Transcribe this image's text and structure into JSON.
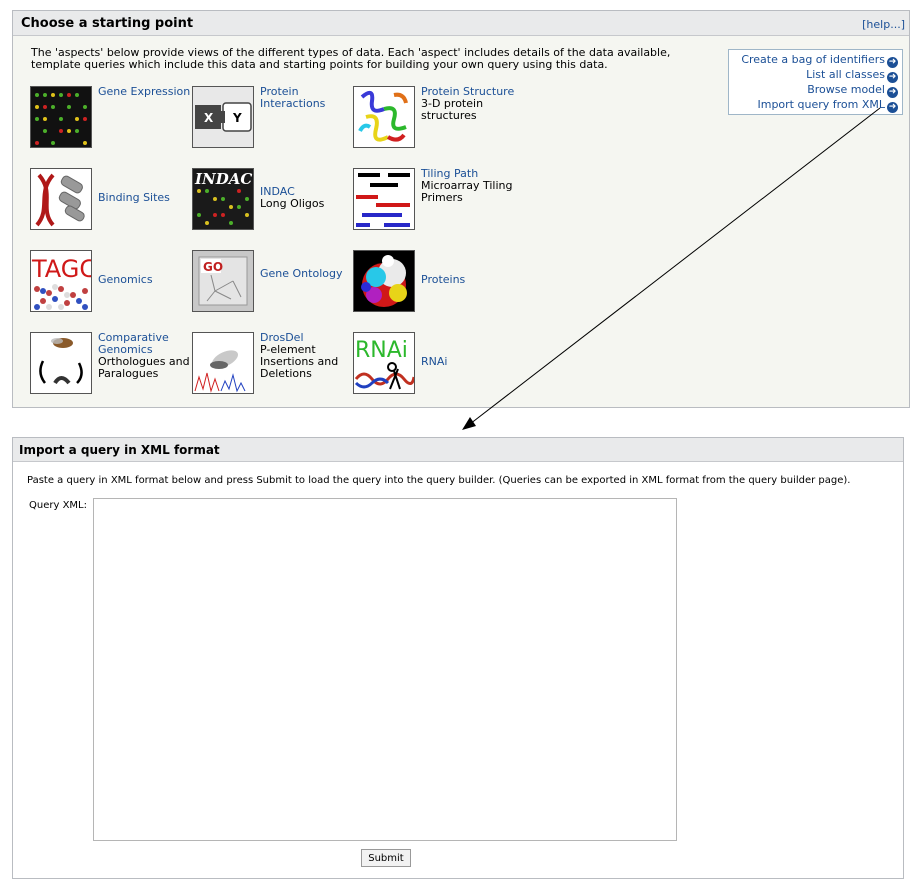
{
  "top_panel": {
    "title": "Choose a starting point",
    "help": "[help...]",
    "intro": "The 'aspects' below provide views of the different types of data. Each 'aspect' includes details of the data available, template queries which include this data and starting points for building your own query using this data.",
    "actions": [
      {
        "label": "Create a bag of identifiers",
        "icon": "arrow-circle-icon"
      },
      {
        "label": "List all classes",
        "icon": "arrow-circle-icon"
      },
      {
        "label": "Browse model",
        "icon": "arrow-circle-icon"
      },
      {
        "label": "Import query from XML",
        "icon": "arrow-circle-icon"
      }
    ],
    "aspects": [
      {
        "link": "Gene Expression",
        "sub": "",
        "icon": "microarray-icon"
      },
      {
        "link": "Protein Interactions",
        "sub": "",
        "icon": "xy-interaction-icon"
      },
      {
        "link": "Protein Structure",
        "sub": "3-D protein structures",
        "icon": "protein-ribbon-icon"
      },
      {
        "link": "Binding Sites",
        "sub": "",
        "icon": "dna-helix-icon"
      },
      {
        "link": "INDAC",
        "sub": "Long Oligos",
        "icon": "indac-icon"
      },
      {
        "link": "Tiling Path",
        "sub": "Microarray Tiling Primers",
        "icon": "tiling-bars-icon"
      },
      {
        "link": "Genomics",
        "sub": "",
        "icon": "tagc-icon"
      },
      {
        "link": "Gene Ontology",
        "sub": "",
        "icon": "go-graph-icon"
      },
      {
        "link": "Proteins",
        "sub": "",
        "icon": "protein-spheres-icon"
      },
      {
        "link": "Comparative Genomics",
        "sub": "Orthologues and Paralogues",
        "icon": "fly-cycle-icon"
      },
      {
        "link": "DrosDel",
        "sub": "P-element Insertions and Deletions",
        "icon": "fly-trace-icon"
      },
      {
        "link": "RNAi",
        "sub": "",
        "icon": "rnai-scissors-icon"
      }
    ],
    "indac_text": "INDAC",
    "tagc_text": "TAGC",
    "go_text": "GO",
    "rnai_text": "RNAi",
    "x_text": "X",
    "y_text": "Y"
  },
  "bottom_panel": {
    "title": "Import a query in XML format",
    "description": "Paste a query in XML format below and press Submit to load the query into the query builder. (Queries can be exported in XML format from the query builder page).",
    "field_label": "Query XML:",
    "field_value": "",
    "submit_label": "Submit"
  },
  "colors": {
    "link": "#1b4f96",
    "header_bg": "#e9eaeb",
    "panel_bg": "#f5f6f1"
  }
}
